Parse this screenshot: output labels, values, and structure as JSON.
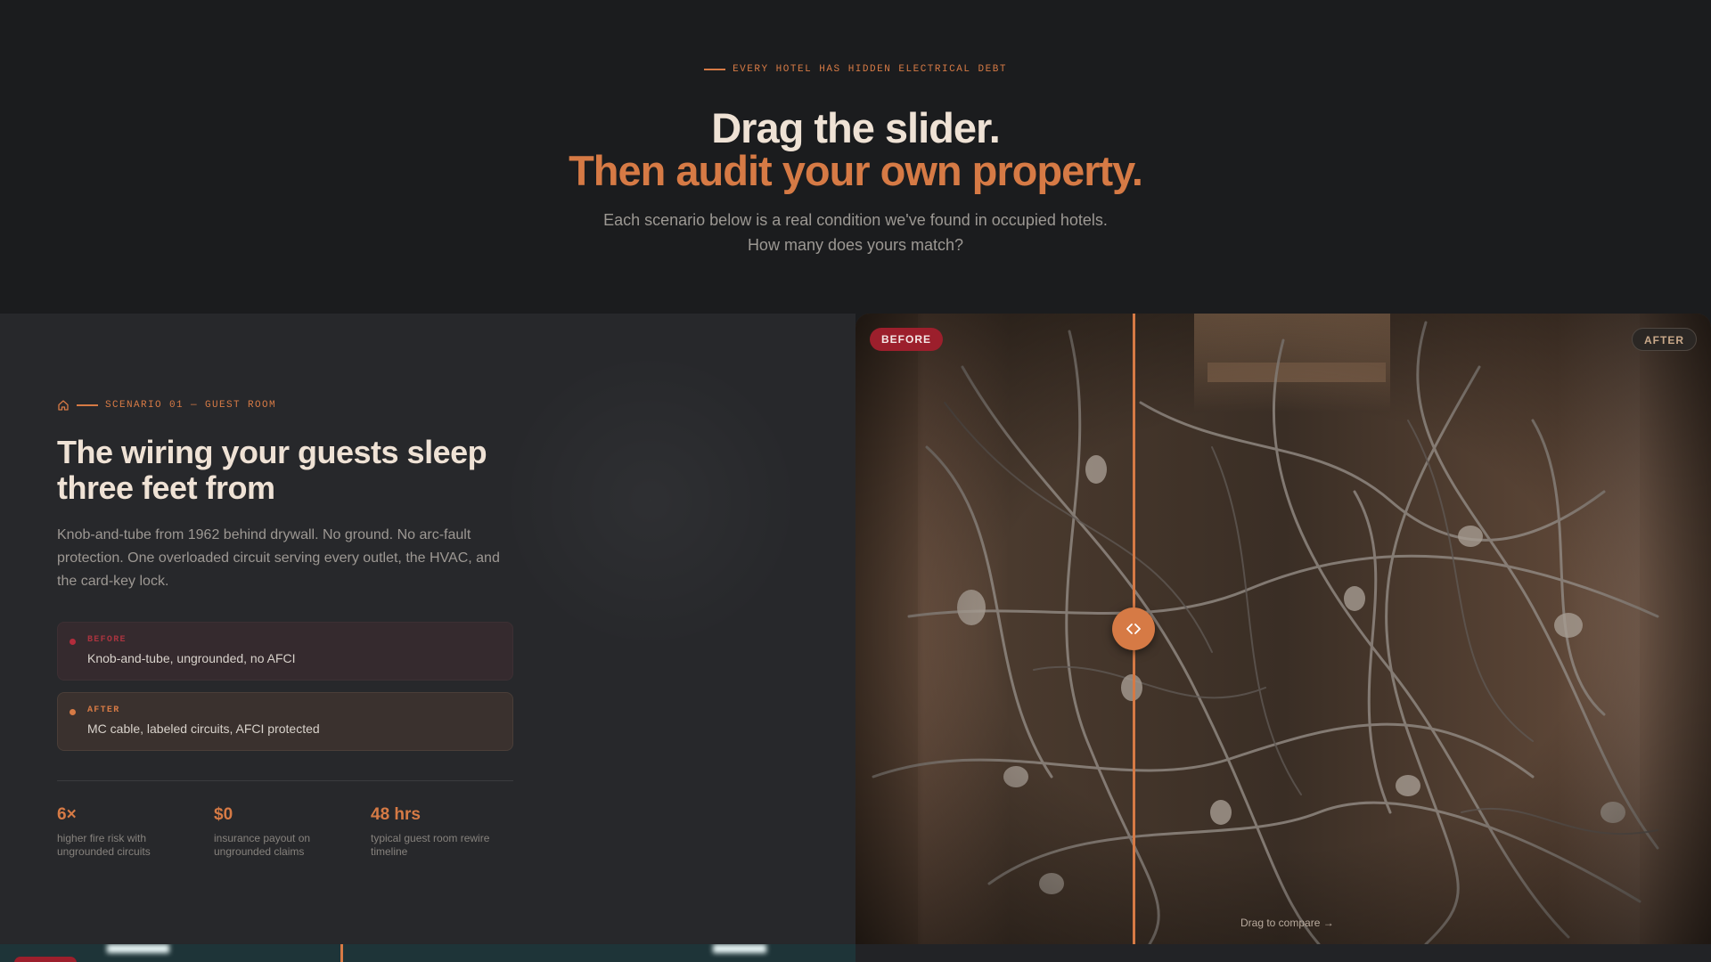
{
  "hero": {
    "eyebrow": "EVERY HOTEL HAS HIDDEN ELECTRICAL DEBT",
    "title_line1": "Drag the slider.",
    "title_line2": "Then audit your own property.",
    "subtitle_line1": "Each scenario below is a real condition we've found in occupied hotels.",
    "subtitle_line2": "How many does yours match?"
  },
  "scenario": {
    "icon": "home-icon",
    "label": "SCENARIO 01 — GUEST ROOM",
    "title": "The wiring your guests sleep three feet from",
    "description": "Knob-and-tube from 1962 behind drywall. No ground. No arc-fault protection. One overloaded circuit serving every outlet, the HVAC, and the card-key lock.",
    "before": {
      "label": "BEFORE",
      "value": "Knob-and-tube, ungrounded, no AFCI"
    },
    "after": {
      "label": "AFTER",
      "value": "MC cable, labeled circuits, AFCI protected"
    },
    "stats": [
      {
        "value": "6×",
        "caption": "higher fire risk with ungrounded circuits"
      },
      {
        "value": "$0",
        "caption": "insurance payout on ungrounded claims"
      },
      {
        "value": "48 hrs",
        "caption": "typical guest room rewire timeline"
      }
    ]
  },
  "compare": {
    "before_badge": "BEFORE",
    "after_badge": "AFTER",
    "hint": "Drag to compare →",
    "slider_position": 0.4,
    "handle_icon": "chevron-left-right-icon"
  },
  "colors": {
    "accent": "#d67a45",
    "before_red": "#9c1f2c",
    "background": "#1b1c1e",
    "panel": "#27282b"
  }
}
